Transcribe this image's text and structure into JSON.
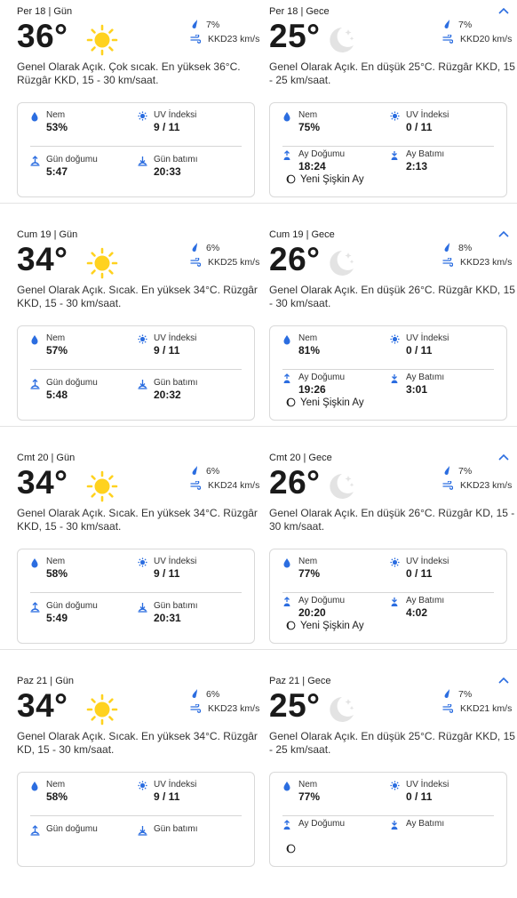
{
  "days": [
    {
      "day": {
        "header": "Per 18 | Gün",
        "temp": "36°",
        "precip": "7%",
        "wind": "KKD23 km/s",
        "desc": "Genel Olarak Açık. Çok sıcak. En yüksek 36°C. Rüzgâr KKD, 15 - 30 km/saat.",
        "humidity_label": "Nem",
        "humidity": "53%",
        "uv_label": "UV İndeksi",
        "uv": "9 / 11",
        "rise_label": "Gün doğumu",
        "rise": "5:47",
        "set_label": "Gün batımı",
        "set": "20:33"
      },
      "night": {
        "header": "Per 18 | Gece",
        "temp": "25°",
        "precip": "7%",
        "wind": "KKD20 km/s",
        "desc": "Genel Olarak Açık. En düşük 25°C. Rüzgâr KKD, 15 - 25 km/saat.",
        "humidity_label": "Nem",
        "humidity": "75%",
        "uv_label": "UV İndeksi",
        "uv": "0 / 11",
        "rise_label": "Ay Doğumu",
        "rise": "18:24",
        "set_label": "Ay Batımı",
        "set": "2:13",
        "moon_phase": "Yeni Şişkin Ay"
      }
    },
    {
      "day": {
        "header": "Cum 19 | Gün",
        "temp": "34°",
        "precip": "6%",
        "wind": "KKD25 km/s",
        "desc": "Genel Olarak Açık. Sıcak. En yüksek 34°C. Rüzgâr KKD, 15 - 30 km/saat.",
        "humidity_label": "Nem",
        "humidity": "57%",
        "uv_label": "UV İndeksi",
        "uv": "9 / 11",
        "rise_label": "Gün doğumu",
        "rise": "5:48",
        "set_label": "Gün batımı",
        "set": "20:32"
      },
      "night": {
        "header": "Cum 19 | Gece",
        "temp": "26°",
        "precip": "8%",
        "wind": "KKD23 km/s",
        "desc": "Genel Olarak Açık. En düşük 26°C. Rüzgâr KKD, 15 - 30 km/saat.",
        "humidity_label": "Nem",
        "humidity": "81%",
        "uv_label": "UV İndeksi",
        "uv": "0 / 11",
        "rise_label": "Ay Doğumu",
        "rise": "19:26",
        "set_label": "Ay Batımı",
        "set": "3:01",
        "moon_phase": "Yeni Şişkin Ay"
      }
    },
    {
      "day": {
        "header": "Cmt 20 | Gün",
        "temp": "34°",
        "precip": "6%",
        "wind": "KKD24 km/s",
        "desc": "Genel Olarak Açık. Sıcak. En yüksek 34°C. Rüzgâr KKD, 15 - 30 km/saat.",
        "humidity_label": "Nem",
        "humidity": "58%",
        "uv_label": "UV İndeksi",
        "uv": "9 / 11",
        "rise_label": "Gün doğumu",
        "rise": "5:49",
        "set_label": "Gün batımı",
        "set": "20:31"
      },
      "night": {
        "header": "Cmt 20 | Gece",
        "temp": "26°",
        "precip": "7%",
        "wind": "KKD23 km/s",
        "desc": "Genel Olarak Açık. En düşük 26°C. Rüzgâr KD, 15 - 30 km/saat.",
        "humidity_label": "Nem",
        "humidity": "77%",
        "uv_label": "UV İndeksi",
        "uv": "0 / 11",
        "rise_label": "Ay Doğumu",
        "rise": "20:20",
        "set_label": "Ay Batımı",
        "set": "4:02",
        "moon_phase": "Yeni Şişkin Ay"
      }
    },
    {
      "day": {
        "header": "Paz 21 | Gün",
        "temp": "34°",
        "precip": "6%",
        "wind": "KKD23 km/s",
        "desc": "Genel Olarak Açık. Sıcak. En yüksek 34°C. Rüzgâr KD, 15 - 30 km/saat.",
        "humidity_label": "Nem",
        "humidity": "58%",
        "uv_label": "UV İndeksi",
        "uv": "9 / 11",
        "rise_label": "Gün doğumu",
        "rise": "",
        "set_label": "Gün batımı",
        "set": ""
      },
      "night": {
        "header": "Paz 21 | Gece",
        "temp": "25°",
        "precip": "7%",
        "wind": "KKD21 km/s",
        "desc": "Genel Olarak Açık. En düşük 25°C. Rüzgâr KKD, 15 - 25 km/saat.",
        "humidity_label": "Nem",
        "humidity": "77%",
        "uv_label": "UV İndeksi",
        "uv": "0 / 11",
        "rise_label": "Ay Doğumu",
        "rise": "",
        "set_label": "Ay Batımı",
        "set": "",
        "moon_phase": ""
      }
    }
  ],
  "icons": {
    "collapse": "chevron-up-icon",
    "sun": "sun-icon",
    "moon": "moon-icon",
    "drop": "humidity-drop-icon",
    "uv": "uv-sun-icon",
    "precip": "rain-drop-icon",
    "wind": "wind-icon"
  },
  "colors": {
    "accent": "#2b6de0",
    "sun": "#ffd21f",
    "moon": "#e2e2e2"
  }
}
